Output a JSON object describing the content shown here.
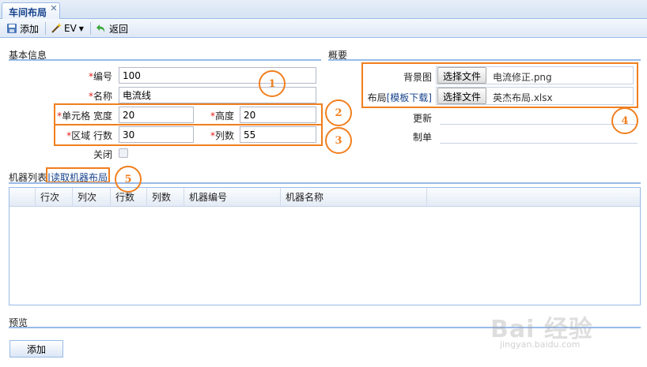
{
  "tab": {
    "title": "车间布局"
  },
  "toolbar": {
    "add": "添加",
    "ev": "EV",
    "back": "返回"
  },
  "basic": {
    "title": "基本信息",
    "code": {
      "label": "编号",
      "value": "100"
    },
    "name": {
      "label": "名称",
      "value": "电流线"
    },
    "cell_width": {
      "label": "单元格 宽度",
      "value": "20"
    },
    "height": {
      "label": "高度",
      "value": "20"
    },
    "area_rows": {
      "label": "区域 行数",
      "value": "30"
    },
    "cols": {
      "label": "列数",
      "value": "55"
    },
    "closed": {
      "label": "关闭"
    },
    "required_mark": "*"
  },
  "overview": {
    "title": "概要",
    "bg_label": "背景图",
    "layout_label": "布局",
    "layout_link": "[模板下载]",
    "choose_file": "选择文件",
    "bg_file": "电流修正.png",
    "layout_file": "英杰布局.xlsx",
    "update_label": "更新",
    "maker_label": "制单"
  },
  "machines": {
    "title": "机器列表",
    "read_link": "|读取机器布局",
    "columns": [
      "行次",
      "列次",
      "行数",
      "列数",
      "机器编号",
      "机器名称"
    ]
  },
  "preview": {
    "title": "预览",
    "add_button": "添加"
  },
  "annotations": [
    "1",
    "2",
    "3",
    "4",
    "5"
  ],
  "watermark": {
    "text": "Bai 经验",
    "sub": "jingyan.baidu.com"
  },
  "colors": {
    "accent": "#99bbe8",
    "required": "#e0201b",
    "annotation": "#f07f1e",
    "link": "#15428b"
  }
}
